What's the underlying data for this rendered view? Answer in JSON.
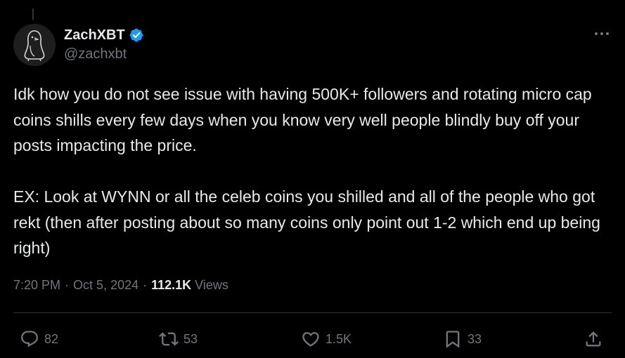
{
  "author": {
    "display_name": "ZachXBT",
    "handle": "@zachxbt"
  },
  "tweet": {
    "paragraphs": [
      "Idk how you do not see issue with having 500K+ followers and rotating micro cap coins shills every few days when you know very well people blindly buy off your posts impacting the price.",
      "EX: Look at WYNN or all the celeb coins you shilled and all of the people who got  rekt (then after posting about so many coins only point out 1-2 which end up being right)"
    ]
  },
  "meta": {
    "time": "7:20 PM",
    "separator": "·",
    "date": "Oct 5, 2024",
    "views_count": "112.1K",
    "views_label": "Views"
  },
  "actions": {
    "replies": "82",
    "reposts": "53",
    "likes": "1.5K",
    "bookmarks": "33"
  },
  "icons": {
    "verified": "verified-badge-icon",
    "more": "more-dots-icon",
    "reply": "reply-icon",
    "repost": "repost-icon",
    "like": "heart-icon",
    "bookmark": "bookmark-icon",
    "share": "share-icon"
  },
  "colors": {
    "background": "#000000",
    "text": "#e7e9ea",
    "muted": "#71767b",
    "verified": "#1d9bf0",
    "divider": "#2f3336"
  }
}
